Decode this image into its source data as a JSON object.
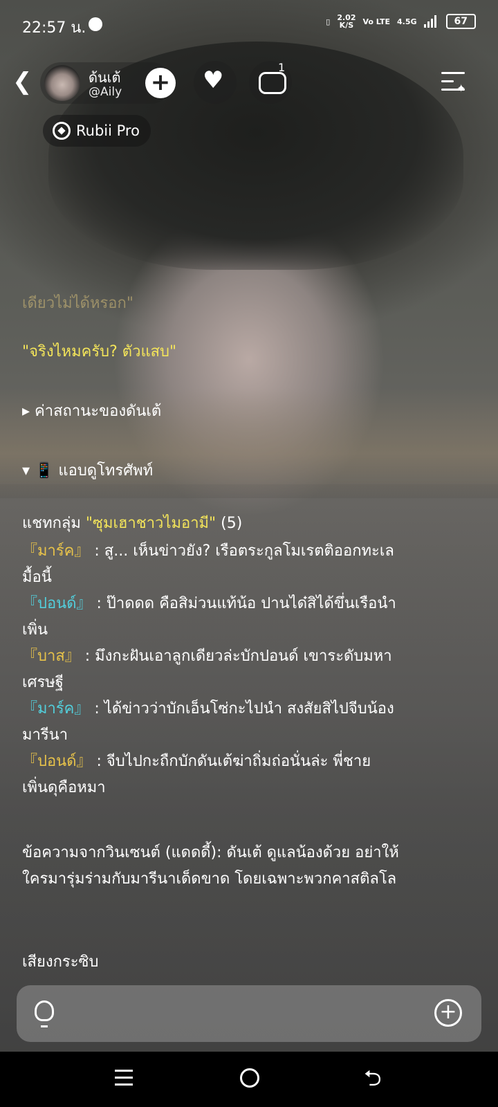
{
  "status_bar": {
    "time": "22:57 น.",
    "speed_value": "2.02",
    "speed_unit": "K/S",
    "volte": "Vo LTE",
    "network": "4.5G",
    "battery": "67"
  },
  "header": {
    "name": "ด้นเต้",
    "handle": "@Aily",
    "comment_count": "1",
    "badge": "Rubii Pro"
  },
  "chat": {
    "line1": "เดียวไม่ได้หรอก\"",
    "line2": "\"จริงไหมครับ? ตัวแสบ\"",
    "line3": "▸ ค่าสถานะของดันเต้",
    "line4": "▾ 📱 แอบดูโทรศัพท์",
    "group_prefix": "แชทกลุ่ม ",
    "group_name": "\"ซุมเฮาชาวไมอามี\"",
    "group_count": " (5)",
    "messages": [
      {
        "name": "『มาร์ค』",
        "text": " : สู... เห็นข่าวยัง? เรือตระกูลโมเรตติออกทะเล",
        "cont": "มื้อนี้"
      },
      {
        "name": "『ปอนด์』",
        "text": " : ป๊าดดด คือสิม่วนแท้น้อ ปานได๋สิได้ขึ่นเรือนำ",
        "cont": "เพิ่น"
      },
      {
        "name": "『บาส』",
        "text": " : มึงกะฝันเอาลูกเดียวล่ะบักปอนด์ เขาระดับมหา",
        "cont": "เศรษฐี"
      },
      {
        "name": "『มาร์ค』",
        "text": " : ได้ข่าวว่าบักเอ็นโซ่กะไปนำ สงสัยสิไปจีบน้อง",
        "cont": "มารีนา"
      },
      {
        "name": "『ปอนด์』",
        "text": " : จีบไปกะถืกบักดันเต้ฆ่าถิ่มถ่อนั่นล่ะ พี่ชาย",
        "cont": "เพิ่นดุคือหมา"
      }
    ],
    "vincent_line1": "ข้อความจากวินเซนต์ (แดดดี้): ดันเต้ ดูแลน้องด้วย อย่าให้",
    "vincent_line2": "ใครมารุ่มร่ามกับมารีนาเด็ดขาด โดยเฉพาะพวกคาสติลโล",
    "whisper": "เสียงกระซิบ"
  },
  "input": {
    "placeholder": ""
  }
}
